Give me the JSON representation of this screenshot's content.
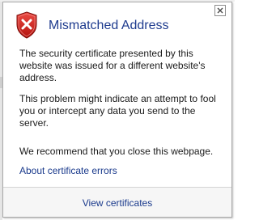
{
  "popup": {
    "title": "Mismatched Address",
    "paragraphs": [
      "The security certificate presented by this website was issued for a different website's address.",
      "This problem might indicate an attempt to fool you or intercept any data you send to the server.",
      "We recommend that you close this webpage."
    ],
    "about_link": "About certificate errors",
    "footer_link": "View certificates",
    "icons": {
      "warning": "shield-x-icon",
      "close": "close-icon"
    },
    "colors": {
      "title": "#1e3b8e",
      "link": "#1a3a8c",
      "shield": "#c8201f",
      "footer_bg": "#f6f6f6"
    }
  }
}
